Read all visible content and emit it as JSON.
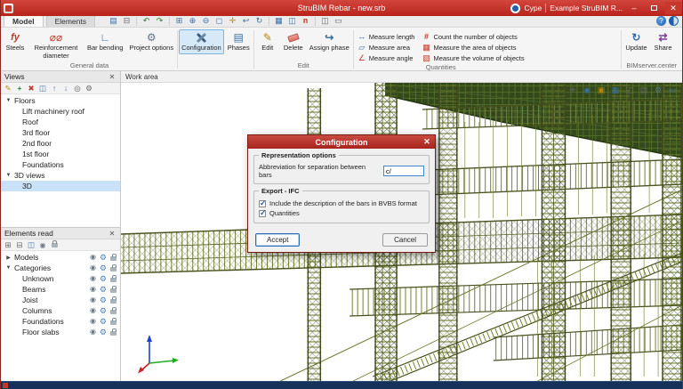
{
  "window": {
    "title": "StruBIM Rebar - new.srb",
    "brand": "Cype",
    "project": "Example StruBIM R..."
  },
  "tabs": {
    "model": "Model",
    "elements": "Elements"
  },
  "ribbon": {
    "general": {
      "label": "General data",
      "steels": "Steels",
      "reinforcement_diameter": "Reinforcement diameter",
      "bar_bending": "Bar bending",
      "project_options": "Project options",
      "configuration": "Configuration",
      "phases": "Phases"
    },
    "edit": {
      "label": "Edit",
      "edit": "Edit",
      "delete": "Delete",
      "assign_phase": "Assign phase"
    },
    "quantities": {
      "label": "Quantities",
      "items": [
        "Measure length",
        "Measure area",
        "Measure angle",
        "Count the number of objects",
        "Measure the area of objects",
        "Measure the volume of objects"
      ]
    },
    "bimserver": {
      "label": "BIMserver.center",
      "update": "Update",
      "share": "Share"
    }
  },
  "views_panel": {
    "title": "Views",
    "groups": [
      {
        "label": "Floors",
        "children": [
          "Lift machinery roof",
          "Roof",
          "3rd floor",
          "2nd floor",
          "1st floor",
          "Foundations"
        ]
      },
      {
        "label": "3D views",
        "children": [
          "3D"
        ]
      }
    ],
    "selected": "3D"
  },
  "elements_panel": {
    "title": "Elements read",
    "models_label": "Models",
    "categories_label": "Categories",
    "categories": [
      "Unknown",
      "Beams",
      "Joist",
      "Columns",
      "Foundations",
      "Floor slabs"
    ]
  },
  "work_area": {
    "label": "Work area"
  },
  "dialog": {
    "title": "Configuration",
    "representation": {
      "title": "Representation options",
      "field_label": "Abbreviation for separation between bars",
      "field_value": "c/"
    },
    "export_ifc": {
      "title": "Export - IFC",
      "checkbox1": "Include the description of the bars in BVBS format",
      "checkbox1_checked": true,
      "checkbox2": "Quantities",
      "checkbox2_checked": true
    },
    "accept": "Accept",
    "cancel": "Cancel"
  },
  "colors": {
    "titlebar_red": "#c22a20",
    "dialog_title_red": "#a6241c",
    "selection_blue": "#c9e2f8",
    "rebar_olive": "#6d7629",
    "status_navy": "#16325a"
  },
  "icons": {
    "close": "✕",
    "minimize": "–",
    "help": "?",
    "save": "▤",
    "print": "⊟",
    "undo": "↶",
    "redo": "↷",
    "zoom_window": "⊞",
    "zoom_in": "⊕",
    "zoom_out": "⊖",
    "zoom_extents": "◻",
    "pan": "✛",
    "previous_view": "↩",
    "redraw": "↻",
    "table": "▦",
    "layout_columns": "◫",
    "cype_n": "n",
    "tile": "◫",
    "monitor": "▭",
    "steels": "fy",
    "rebar_diameter": "⌀⌀",
    "bar_bending": "∟",
    "project_options": "⚙",
    "phases": "▤",
    "edit": "✎",
    "assign_phase": "↪",
    "measure_length": "↔",
    "measure_area": "▱",
    "measure_angle": "∠",
    "count_objects": "#",
    "area_objects": "▦",
    "volume_objects": "▧",
    "update": "↻",
    "share": "⇄",
    "eye": "◉",
    "gear": "⚙",
    "tree_expanded": "▼",
    "tree_collapsed": "▶",
    "check": "✓",
    "views_edit": "✎",
    "views_add": "+",
    "views_delete": "✖",
    "views_duplicate": "◫",
    "views_up": "↑",
    "views_down": "↓",
    "views_isolate": "◎",
    "views_settings": "⚙",
    "elements_expand": "⊞",
    "elements_collapse": "⊟",
    "elements_columns": "◫",
    "wa_pan": "✛",
    "wa_eye": "◉",
    "wa_solid": "▣",
    "wa_grid": "▦",
    "wa_split": "◫",
    "wa_layers": "▤",
    "wa_settings": "⚙",
    "wa_monitor": "▭"
  }
}
